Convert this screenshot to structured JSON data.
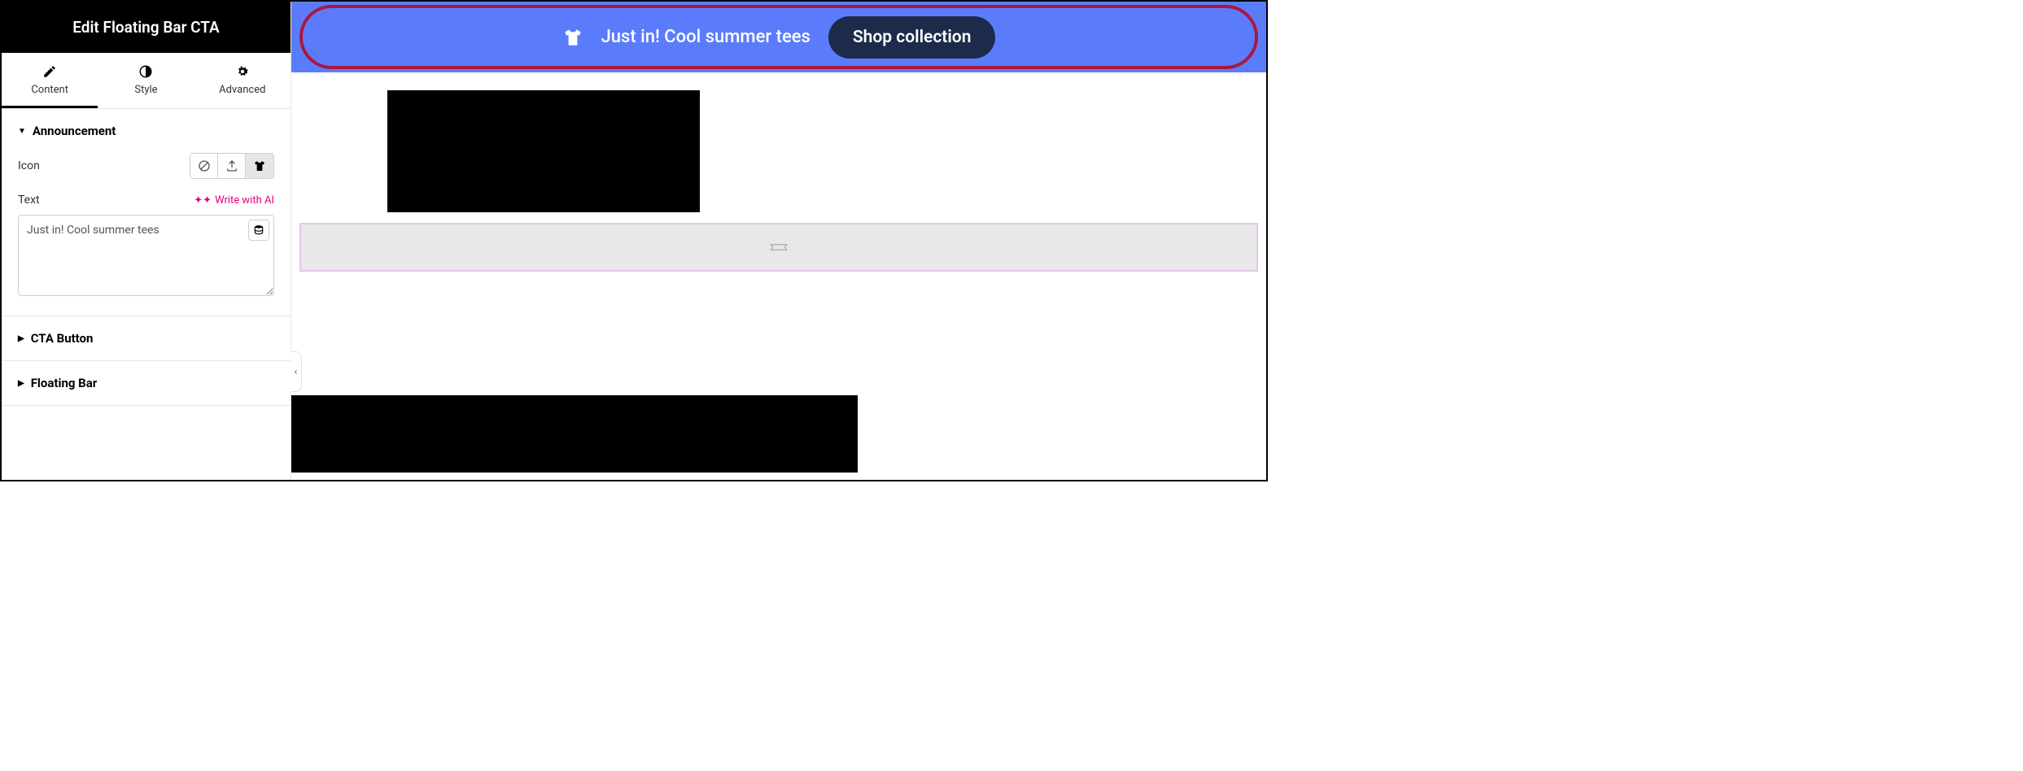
{
  "sidebar": {
    "title": "Edit Floating Bar CTA",
    "tabs": {
      "content": "Content",
      "style": "Style",
      "advanced": "Advanced"
    },
    "sections": {
      "announcement": {
        "title": "Announcement",
        "icon_label": "Icon",
        "text_label": "Text",
        "ai_link": "Write with AI",
        "text_value": "Just in! Cool summer tees"
      },
      "cta_button": {
        "title": "CTA Button"
      },
      "floating_bar": {
        "title": "Floating Bar"
      }
    }
  },
  "preview": {
    "bar_text": "Just in! Cool summer tees",
    "button_label": "Shop collection"
  },
  "colors": {
    "bar_bg": "#5b7cfa",
    "button_bg": "#1c2b4a",
    "highlight": "#a8183f",
    "ai_accent": "#e6007e"
  }
}
